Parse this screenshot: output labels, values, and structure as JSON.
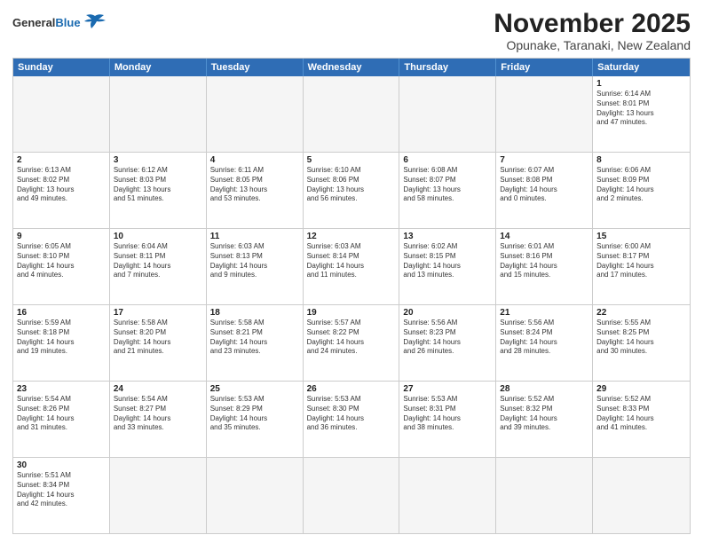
{
  "header": {
    "logo_general": "General",
    "logo_blue": "Blue",
    "title": "November 2025",
    "subtitle": "Opunake, Taranaki, New Zealand"
  },
  "calendar": {
    "days": [
      "Sunday",
      "Monday",
      "Tuesday",
      "Wednesday",
      "Thursday",
      "Friday",
      "Saturday"
    ],
    "rows": [
      [
        {
          "day": "",
          "text": ""
        },
        {
          "day": "",
          "text": ""
        },
        {
          "day": "",
          "text": ""
        },
        {
          "day": "",
          "text": ""
        },
        {
          "day": "",
          "text": ""
        },
        {
          "day": "",
          "text": ""
        },
        {
          "day": "1",
          "text": "Sunrise: 6:14 AM\nSunset: 8:01 PM\nDaylight: 13 hours\nand 47 minutes."
        }
      ],
      [
        {
          "day": "2",
          "text": "Sunrise: 6:13 AM\nSunset: 8:02 PM\nDaylight: 13 hours\nand 49 minutes."
        },
        {
          "day": "3",
          "text": "Sunrise: 6:12 AM\nSunset: 8:03 PM\nDaylight: 13 hours\nand 51 minutes."
        },
        {
          "day": "4",
          "text": "Sunrise: 6:11 AM\nSunset: 8:05 PM\nDaylight: 13 hours\nand 53 minutes."
        },
        {
          "day": "5",
          "text": "Sunrise: 6:10 AM\nSunset: 8:06 PM\nDaylight: 13 hours\nand 56 minutes."
        },
        {
          "day": "6",
          "text": "Sunrise: 6:08 AM\nSunset: 8:07 PM\nDaylight: 13 hours\nand 58 minutes."
        },
        {
          "day": "7",
          "text": "Sunrise: 6:07 AM\nSunset: 8:08 PM\nDaylight: 14 hours\nand 0 minutes."
        },
        {
          "day": "8",
          "text": "Sunrise: 6:06 AM\nSunset: 8:09 PM\nDaylight: 14 hours\nand 2 minutes."
        }
      ],
      [
        {
          "day": "9",
          "text": "Sunrise: 6:05 AM\nSunset: 8:10 PM\nDaylight: 14 hours\nand 4 minutes."
        },
        {
          "day": "10",
          "text": "Sunrise: 6:04 AM\nSunset: 8:11 PM\nDaylight: 14 hours\nand 7 minutes."
        },
        {
          "day": "11",
          "text": "Sunrise: 6:03 AM\nSunset: 8:13 PM\nDaylight: 14 hours\nand 9 minutes."
        },
        {
          "day": "12",
          "text": "Sunrise: 6:03 AM\nSunset: 8:14 PM\nDaylight: 14 hours\nand 11 minutes."
        },
        {
          "day": "13",
          "text": "Sunrise: 6:02 AM\nSunset: 8:15 PM\nDaylight: 14 hours\nand 13 minutes."
        },
        {
          "day": "14",
          "text": "Sunrise: 6:01 AM\nSunset: 8:16 PM\nDaylight: 14 hours\nand 15 minutes."
        },
        {
          "day": "15",
          "text": "Sunrise: 6:00 AM\nSunset: 8:17 PM\nDaylight: 14 hours\nand 17 minutes."
        }
      ],
      [
        {
          "day": "16",
          "text": "Sunrise: 5:59 AM\nSunset: 8:18 PM\nDaylight: 14 hours\nand 19 minutes."
        },
        {
          "day": "17",
          "text": "Sunrise: 5:58 AM\nSunset: 8:20 PM\nDaylight: 14 hours\nand 21 minutes."
        },
        {
          "day": "18",
          "text": "Sunrise: 5:58 AM\nSunset: 8:21 PM\nDaylight: 14 hours\nand 23 minutes."
        },
        {
          "day": "19",
          "text": "Sunrise: 5:57 AM\nSunset: 8:22 PM\nDaylight: 14 hours\nand 24 minutes."
        },
        {
          "day": "20",
          "text": "Sunrise: 5:56 AM\nSunset: 8:23 PM\nDaylight: 14 hours\nand 26 minutes."
        },
        {
          "day": "21",
          "text": "Sunrise: 5:56 AM\nSunset: 8:24 PM\nDaylight: 14 hours\nand 28 minutes."
        },
        {
          "day": "22",
          "text": "Sunrise: 5:55 AM\nSunset: 8:25 PM\nDaylight: 14 hours\nand 30 minutes."
        }
      ],
      [
        {
          "day": "23",
          "text": "Sunrise: 5:54 AM\nSunset: 8:26 PM\nDaylight: 14 hours\nand 31 minutes."
        },
        {
          "day": "24",
          "text": "Sunrise: 5:54 AM\nSunset: 8:27 PM\nDaylight: 14 hours\nand 33 minutes."
        },
        {
          "day": "25",
          "text": "Sunrise: 5:53 AM\nSunset: 8:29 PM\nDaylight: 14 hours\nand 35 minutes."
        },
        {
          "day": "26",
          "text": "Sunrise: 5:53 AM\nSunset: 8:30 PM\nDaylight: 14 hours\nand 36 minutes."
        },
        {
          "day": "27",
          "text": "Sunrise: 5:53 AM\nSunset: 8:31 PM\nDaylight: 14 hours\nand 38 minutes."
        },
        {
          "day": "28",
          "text": "Sunrise: 5:52 AM\nSunset: 8:32 PM\nDaylight: 14 hours\nand 39 minutes."
        },
        {
          "day": "29",
          "text": "Sunrise: 5:52 AM\nSunset: 8:33 PM\nDaylight: 14 hours\nand 41 minutes."
        }
      ],
      [
        {
          "day": "30",
          "text": "Sunrise: 5:51 AM\nSunset: 8:34 PM\nDaylight: 14 hours\nand 42 minutes."
        },
        {
          "day": "",
          "text": ""
        },
        {
          "day": "",
          "text": ""
        },
        {
          "day": "",
          "text": ""
        },
        {
          "day": "",
          "text": ""
        },
        {
          "day": "",
          "text": ""
        },
        {
          "day": "",
          "text": ""
        }
      ]
    ]
  }
}
